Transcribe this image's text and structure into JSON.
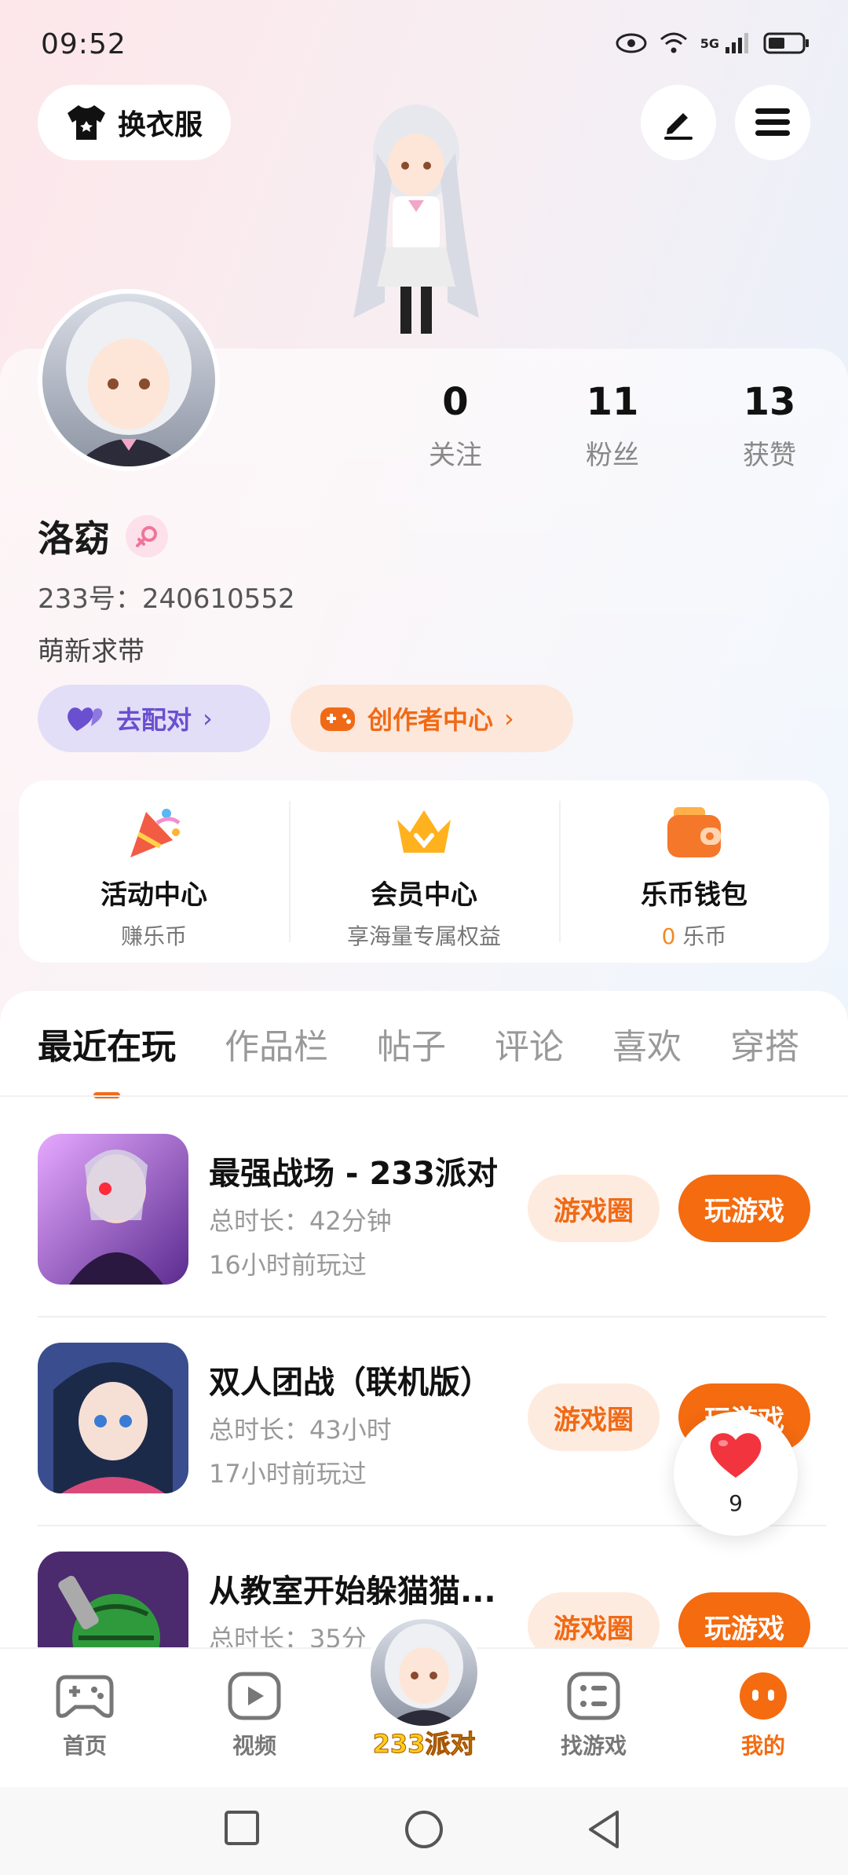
{
  "status": {
    "time": "09:52",
    "network": "5G"
  },
  "header": {
    "outfit_label": "换衣服",
    "edit_icon": "pen-icon",
    "menu_icon": "hamburger-icon"
  },
  "profile": {
    "stats": [
      {
        "value": "0",
        "label": "关注"
      },
      {
        "value": "11",
        "label": "粉丝"
      },
      {
        "value": "13",
        "label": "获赞"
      }
    ],
    "name": "洛窈",
    "id_text": "233号：240610552",
    "bio": "萌新求带",
    "match_label": "去配对",
    "creator_label": "创作者中心"
  },
  "services": [
    {
      "title": "活动中心",
      "sub": "赚乐币",
      "icon": "party-popper-icon"
    },
    {
      "title": "会员中心",
      "sub": "享海量专属权益",
      "icon": "crown-icon"
    },
    {
      "title": "乐币钱包",
      "sub_count": "0",
      "sub_unit": " 乐币",
      "icon": "wallet-icon"
    }
  ],
  "tabs": [
    "最近在玩",
    "作品栏",
    "帖子",
    "评论",
    "喜欢",
    "穿搭"
  ],
  "games": [
    {
      "title": "最强战场 - 233派对",
      "duration": "总时长：42分钟",
      "last_played": "16小时前玩过",
      "circle_label": "游戏圈",
      "play_label": "玩游戏"
    },
    {
      "title": "双人团战（联机版）",
      "duration": "总时长：43小时",
      "last_played": "17小时前玩过",
      "circle_label": "游戏圈",
      "play_label": "玩游戏"
    },
    {
      "title": "从教室开始躲猫猫...",
      "duration": "总时长：35分",
      "last_played": "",
      "circle_label": "游戏圈",
      "play_label": "玩游戏"
    }
  ],
  "like_float": {
    "count": "9"
  },
  "bottom_nav": [
    {
      "label": "首页",
      "icon": "gamepad-icon"
    },
    {
      "label": "视频",
      "icon": "play-icon"
    },
    {
      "label": "233派对",
      "icon": "avatar-icon"
    },
    {
      "label": "找游戏",
      "icon": "list-icon"
    },
    {
      "label": "我的",
      "icon": "face-icon"
    }
  ],
  "colors": {
    "accent": "#f46b10",
    "purple": "#6a4fd0"
  }
}
